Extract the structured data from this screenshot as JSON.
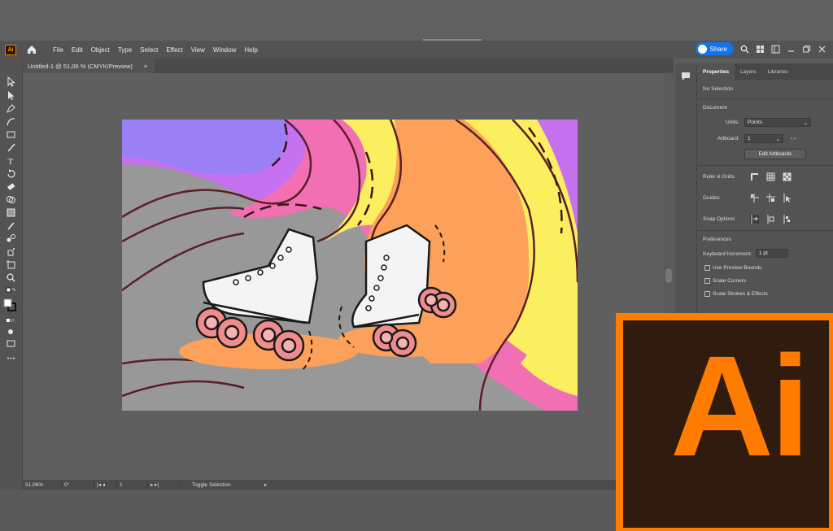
{
  "app": {
    "logo_label": "Ai",
    "menu": [
      "File",
      "Edit",
      "Object",
      "Type",
      "Select",
      "Effect",
      "View",
      "Window",
      "Help"
    ],
    "share_label": "Share"
  },
  "document": {
    "tab_title": "Untitled-1 @ 51,06 % (CMYK/Preview)",
    "tab_close": "×"
  },
  "status": {
    "zoom": "51,06%",
    "rotation": "0°",
    "artboard": "1",
    "mode": "Toggle Selection"
  },
  "properties": {
    "tabs": [
      "Properties",
      "Layers",
      "Libraries"
    ],
    "selection_state": "No Selection",
    "document_heading": "Document",
    "units_label": "Units:",
    "units_value": "Points",
    "artboard_label": "Artboard:",
    "artboard_value": "1",
    "edit_artboards": "Edit Artboards",
    "rulers_grids": "Ruler & Grids",
    "guides": "Guides",
    "snap_options": "Snap Options",
    "preferences": "Preferences",
    "keyboard_increment_label": "Keyboard Increment:",
    "keyboard_increment_value": "1 pt",
    "use_preview_bounds": "Use Preview Bounds",
    "scale_corners": "Scale Corners",
    "scale_strokes": "Scale Strokes & Effects"
  },
  "big_logo": "Ai",
  "colors": {
    "accent_orange": "#ff7c00",
    "logo_bg": "#2f1c0f",
    "share_blue": "#1473e6"
  }
}
